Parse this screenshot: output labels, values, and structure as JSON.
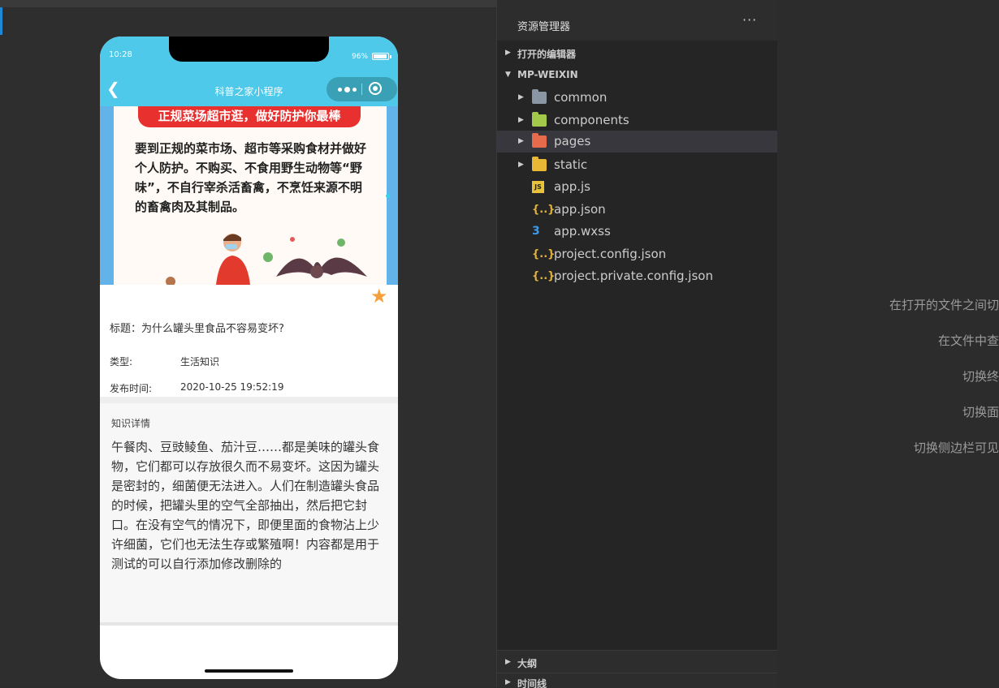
{
  "simulator": {
    "status": {
      "time": "10:28",
      "battery": "96%",
      "battery_level": 0.96
    },
    "navbar": {
      "back_icon": "chevron-left-icon",
      "title": "科普之家小程序"
    },
    "banner": {
      "headline": "正规菜场超市逛，做好防护你最棒",
      "body": "要到正规的菜市场、超市等采购食材并做好个人防护。不购买、不食用野生动物等“野味”，不自行宰杀活畜禽，不烹饪来源不明的畜禽肉及其制品。"
    },
    "article": {
      "title": "标题：为什么罐头里食品不容易变坏?",
      "type_label": "类型:",
      "type_value": "生活知识",
      "time_label": "发布时间:",
      "time_value": "2020-10-25 19:52:19",
      "detail_heading": "知识详情",
      "detail_body": "午餐肉、豆豉鲮鱼、茄汁豆……都是美味的罐头食物，它们都可以存放很久而不易变坏。这因为罐头是密封的，细菌便无法进入。人们在制造罐头食品的时候，把罐头里的空气全部抽出，然后把它封口。在没有空气的情况下，即便里面的食物沾上少许细菌，它们也无法生存或繁殖啊！内容都是用于测试的可以自行添加修改删除的"
    },
    "colors": {
      "navbar": "#4ec9ea",
      "star": "#f5a03a",
      "banner_pill": "#e8302f"
    }
  },
  "explorer": {
    "title": "资源管理器",
    "more": "···",
    "open_editors": "打开的编辑器",
    "project": "MP-WEIXIN",
    "items": [
      {
        "name": "common",
        "icon": "folder-icon",
        "folder": true
      },
      {
        "name": "components",
        "icon": "components-folder-icon",
        "folder": true
      },
      {
        "name": "pages",
        "icon": "pages-folder-icon",
        "folder": true
      },
      {
        "name": "static",
        "icon": "static-folder-icon",
        "folder": true
      },
      {
        "name": "app.js",
        "icon": "js-file-icon",
        "folder": false
      },
      {
        "name": "app.json",
        "icon": "json-file-icon",
        "folder": false
      },
      {
        "name": "app.wxss",
        "icon": "css-file-icon",
        "folder": false
      },
      {
        "name": "project.config.json",
        "icon": "json-file-icon",
        "folder": false
      },
      {
        "name": "project.private.config.json",
        "icon": "json-file-icon",
        "folder": false
      }
    ],
    "outline": "大纲",
    "timeline": "时间线"
  },
  "hints": [
    "在打开的文件之间切",
    "在文件中查",
    "切换终",
    "切换面",
    "切换侧边栏可见"
  ]
}
